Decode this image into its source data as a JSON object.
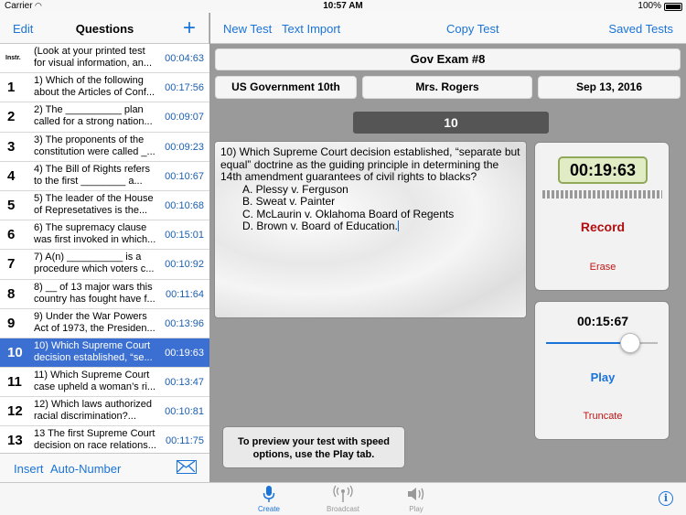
{
  "status": {
    "carrier": "Carrier",
    "time": "10:57 AM",
    "battery": "100%"
  },
  "left": {
    "edit": "Edit",
    "title": "Questions",
    "items": [
      {
        "num": "Instr.",
        "text": "(Look at your printed test for visual information, an...",
        "time": "00:04:63"
      },
      {
        "num": "1",
        "text": "1) Which of the following about the Articles of Conf...",
        "time": "00:17:56"
      },
      {
        "num": "2",
        "text": "2) The __________ plan called for a strong nation...",
        "time": "00:09:07"
      },
      {
        "num": "3",
        "text": "3) The proponents of the constitution were called _...",
        "time": "00:09:23"
      },
      {
        "num": "4",
        "text": "4) The Bill of Rights refers to the first ________ a...",
        "time": "00:10:67"
      },
      {
        "num": "5",
        "text": "5) The leader of the House of Represetatives is the...",
        "time": "00:10:68"
      },
      {
        "num": "6",
        "text": "6) The supremacy clause was first invoked in which...",
        "time": "00:15:01"
      },
      {
        "num": "7",
        "text": "7) A(n) __________ is a procedure which voters c...",
        "time": "00:10:92"
      },
      {
        "num": "8",
        "text": "8) __ of 13 major wars this country has fought have f...",
        "time": "00:11:64"
      },
      {
        "num": "9",
        "text": "9) Under the War Powers Act of 1973, the Presiden...",
        "time": "00:13:96"
      },
      {
        "num": "10",
        "text": "10) Which Supreme Court decision established, “se...",
        "time": "00:19:63"
      },
      {
        "num": "11",
        "text": "11) Which Supreme Court case upheld a woman’s ri...",
        "time": "00:13:47"
      },
      {
        "num": "12",
        "text": "12) Which laws authorized racial discrimination?...",
        "time": "00:10:81"
      },
      {
        "num": "13",
        "text": "13 The first Supreme Court decision on race relations...",
        "time": "00:11:75"
      }
    ],
    "selected_index": 10,
    "insert": "Insert",
    "auto_number": "Auto-Number"
  },
  "toolbar": {
    "new_test": "New Test",
    "text_import": "Text Import",
    "copy_test": "Copy Test",
    "saved_tests": "Saved Tests"
  },
  "exam": {
    "title": "Gov Exam #8",
    "course": "US Government 10th",
    "teacher": "Mrs. Rogers",
    "date": "Sep 13, 2016",
    "question_number": "10"
  },
  "question": {
    "stem": "10) Which Supreme Court decision established, “separate but equal” doctrine as the guiding principle in determining the 14th amendment guarantees of civil rights to blacks?",
    "options": [
      "A. Plessy v. Ferguson",
      "B. Sweat v. Painter",
      "C. McLaurin v. Oklahoma Board of Regents",
      "D. Brown v. Board of Education."
    ]
  },
  "recorder": {
    "timer": "00:19:63",
    "record": "Record",
    "erase": "Erase"
  },
  "player": {
    "timer": "00:15:67",
    "progress": 0.75,
    "play": "Play",
    "truncate": "Truncate"
  },
  "tooltip": "To preview your test with speed options, use the Play tab.",
  "tabs": {
    "create": "Create",
    "broadcast": "Broadcast",
    "play": "Play"
  },
  "icons": {
    "add": "plus-icon",
    "mail": "envelope-icon",
    "create": "microphone-icon",
    "broadcast": "broadcast-icon",
    "play": "speaker-icon",
    "info": "info-icon"
  },
  "colors": {
    "accent": "#1a73d9",
    "selected_row": "#3b6fd1",
    "record": "#b01010",
    "timer_bg": "#e1ecc4"
  }
}
